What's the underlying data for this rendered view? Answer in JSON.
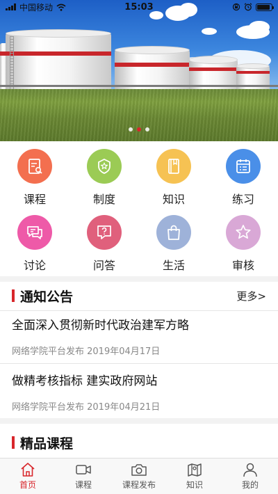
{
  "status_bar": {
    "carrier": "中国移动",
    "time": "15:03",
    "battery_level": 0.9
  },
  "banner": {
    "slide_count": 3,
    "active_slide": 2
  },
  "menu": {
    "items": [
      {
        "label": "课程",
        "icon": "course-icon",
        "color": "#f36f4f"
      },
      {
        "label": "制度",
        "icon": "system-icon",
        "color": "#9bcb55"
      },
      {
        "label": "知识",
        "icon": "knowledge-icon",
        "color": "#f6c253"
      },
      {
        "label": "练习",
        "icon": "practice-icon",
        "color": "#4a8fe8"
      },
      {
        "label": "讨论",
        "icon": "discussion-icon",
        "color": "#ee5aa8"
      },
      {
        "label": "问答",
        "icon": "qa-icon",
        "color": "#e0607c"
      },
      {
        "label": "生活",
        "icon": "life-icon",
        "color": "#9eb2d9"
      },
      {
        "label": "审核",
        "icon": "review-icon",
        "color": "#d9a8d6"
      }
    ]
  },
  "notices": {
    "title": "通知公告",
    "more_label": "更多>",
    "items": [
      {
        "title": "全面深入贯彻新时代政治建军方略",
        "meta": "网络学院平台发布 2019年04月17日"
      },
      {
        "title": "做精考核指标 建实政府网站",
        "meta": "网络学院平台发布 2019年04月21日"
      }
    ]
  },
  "courses": {
    "title": "精品课程"
  },
  "tab_bar": {
    "active_color": "#d8262b",
    "items": [
      {
        "label": "首页",
        "icon": "home-icon",
        "active": true
      },
      {
        "label": "课程",
        "icon": "video-icon",
        "active": false
      },
      {
        "label": "课程发布",
        "icon": "camera-icon",
        "active": false
      },
      {
        "label": "知识",
        "icon": "map-icon",
        "active": false
      },
      {
        "label": "我的",
        "icon": "user-icon",
        "active": false
      }
    ]
  }
}
